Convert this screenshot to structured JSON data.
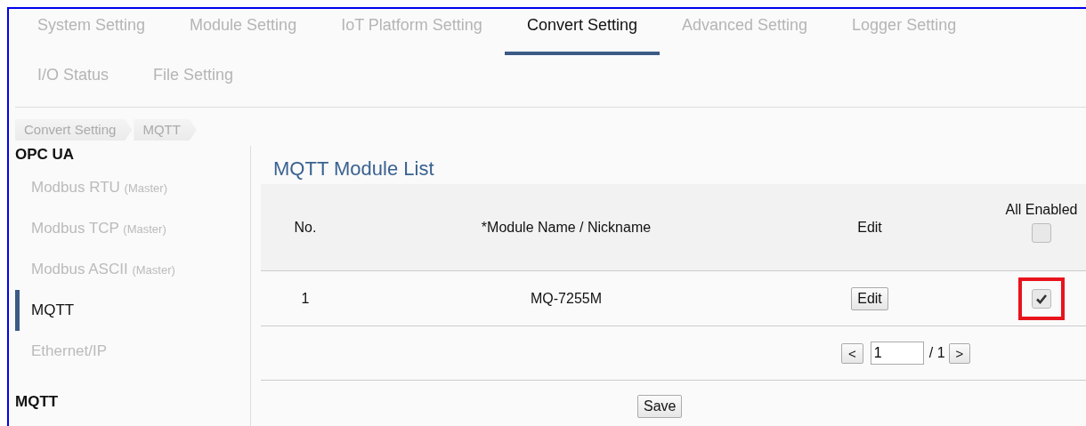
{
  "tabs": [
    {
      "label": "System Setting",
      "selected": false
    },
    {
      "label": "Module Setting",
      "selected": false
    },
    {
      "label": "IoT Platform Setting",
      "selected": false
    },
    {
      "label": "Convert Setting",
      "selected": true
    },
    {
      "label": "Advanced Setting",
      "selected": false
    },
    {
      "label": "Logger Setting",
      "selected": false
    },
    {
      "label": "I/O Status",
      "selected": false
    },
    {
      "label": "File Setting",
      "selected": false
    }
  ],
  "breadcrumb": [
    "Convert Setting",
    "MQTT"
  ],
  "sidebar": {
    "groups": [
      {
        "title": "OPC UA",
        "items": [
          {
            "label": "Modbus RTU",
            "qualifier": "(Master)",
            "selected": false
          },
          {
            "label": "Modbus TCP",
            "qualifier": "(Master)",
            "selected": false
          },
          {
            "label": "Modbus ASCII",
            "qualifier": "(Master)",
            "selected": false
          },
          {
            "label": "MQTT",
            "selected": true
          },
          {
            "label": "Ethernet/IP",
            "selected": false
          }
        ]
      },
      {
        "title": "MQTT"
      }
    ]
  },
  "panel": {
    "title": "MQTT Module List",
    "table": {
      "columns": [
        "No.",
        "*Module Name / Nickname",
        "Edit",
        "All Enabled"
      ],
      "all_enabled_checked": false,
      "rows": [
        {
          "no": "1",
          "name": "MQ-7255M",
          "edit": "Edit",
          "enabled": true,
          "highlighted": true
        }
      ]
    },
    "pager": {
      "prev": "<",
      "page": "1",
      "total": "/ 1",
      "next": ">"
    },
    "save": "Save"
  }
}
